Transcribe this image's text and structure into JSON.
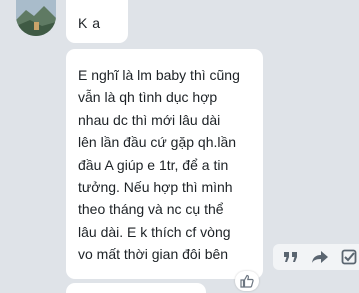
{
  "colors": {
    "background": "#dfe3e8",
    "bubble": "#ffffff",
    "text": "#1d2226",
    "action_icon": "#5a6570"
  },
  "messages": [
    {
      "lines": [
        "K a"
      ]
    },
    {
      "lines": [
        "E nghĩ là lm baby thì cũng",
        "vẫn là qh tình dục hợp",
        "nhau dc thì mới lâu dài",
        "lên lần đầu cứ gặp qh.lần",
        "đầu  A giúp e 1tr, để a tin",
        "tưởng. Nếu hợp thì mình",
        "theo tháng và nc cụ thể",
        "lâu dài. E k thích cf vòng",
        "vo mất thời gian đôi bên"
      ]
    }
  ],
  "icons": {
    "avatar": "avatar-landscape",
    "quote": "quote-icon",
    "share": "share-icon",
    "select": "checkbox-icon",
    "reaction": "thumbs-up-icon"
  }
}
